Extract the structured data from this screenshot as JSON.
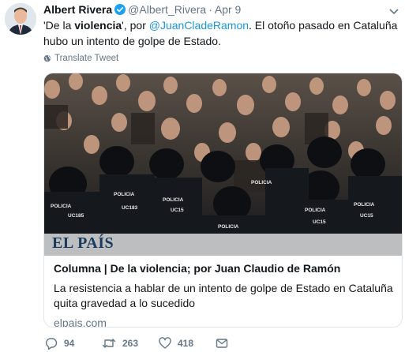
{
  "author": {
    "name": "Albert Rivera",
    "handle": "@Albert_Rivera",
    "separator": "·",
    "date": "Apr 9"
  },
  "tweet": {
    "quote_open": "'De la ",
    "bold_word": "violencia",
    "mid_text": "', por ",
    "mention": "@JuanCladeRamon",
    "rest": ". El otoño pasado en Cataluña hubo un intento de golpe de Estado."
  },
  "translate_label": "Translate Tweet",
  "card": {
    "logo_text": "EL PAÍS",
    "title": "Columna | De la violencia; por Juan Claudio de Ramón",
    "description": "La resistencia a hablar de un intento de golpe de Estado en Cataluña quita gravedad a lo sucedido",
    "domain": "elpais.com",
    "police_labels": [
      "POLICIA",
      "POLICIA",
      "POLICIA",
      "POLICIA",
      "POLICIA",
      "POLICIA",
      "POLICIA"
    ],
    "unit_labels": [
      "UC185",
      "UC183",
      "UC15",
      "UC15",
      "UC15"
    ]
  },
  "actions": {
    "replies": "94",
    "retweets": "263",
    "likes": "418"
  },
  "colors": {
    "link": "#1b95e0",
    "verified": "#1da1f2",
    "muted": "#657786",
    "border": "#e1e8ed"
  }
}
